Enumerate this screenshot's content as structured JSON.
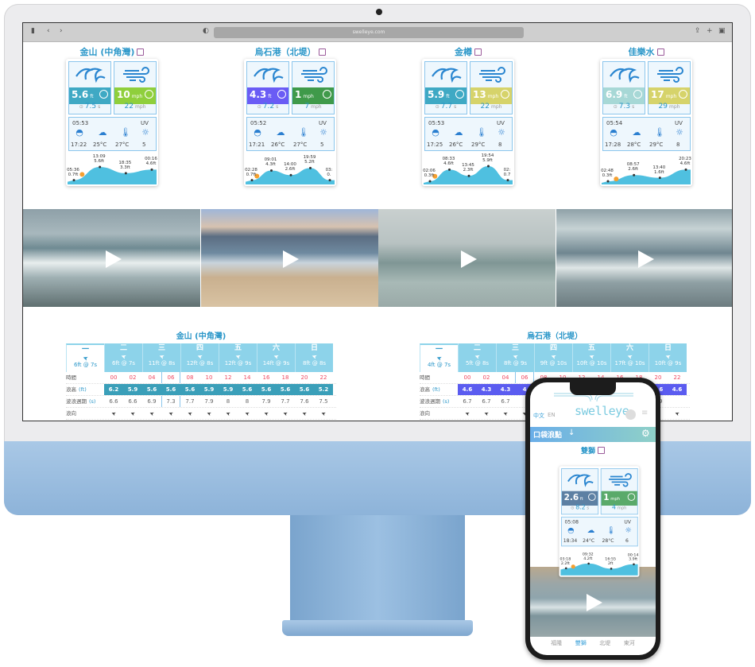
{
  "browser": {
    "url": "swelleye.com"
  },
  "spots": [
    {
      "name": "金山 (中角灣)",
      "wave_height": "5.6",
      "wave_unit": "ft",
      "wave_period": "7.5",
      "period_unit": "s",
      "wave_color": "#3fa9c4",
      "wind_speed": "10",
      "wind_unit": "mph",
      "wind_gust": "22",
      "wind_color": "#8fcf3c",
      "sunrise": "05:53",
      "sunset": "17:22",
      "uv_label": "UV",
      "air_temp": "25°C",
      "water_temp": "27°C",
      "uv": "5",
      "tides": [
        {
          "time": "05:36",
          "height": "0.7ft",
          "v": 0.7
        },
        {
          "time": "13:09",
          "height": "5.6ft",
          "v": 5.6
        },
        {
          "time": "18:35",
          "height": "3.3ft",
          "v": 3.3
        },
        {
          "time": "00:16",
          "height": "4.6ft",
          "v": 4.6
        }
      ]
    },
    {
      "name": "烏石港（北堤）",
      "wave_height": "4.3",
      "wave_unit": "ft",
      "wave_period": "7.2",
      "period_unit": "s",
      "wave_color": "#6a5cf5",
      "wind_speed": "1",
      "wind_unit": "mph",
      "wind_gust": "7",
      "wind_color": "#3f9a4a",
      "sunrise": "05:52",
      "sunset": "17:21",
      "uv_label": "UV",
      "air_temp": "26°C",
      "water_temp": "27°C",
      "uv": "5",
      "tides": [
        {
          "time": "02:28",
          "height": "0.7ft",
          "v": 0.7
        },
        {
          "time": "09:01",
          "height": "4.3ft",
          "v": 4.3
        },
        {
          "time": "14:00",
          "height": "2.6ft",
          "v": 2.6
        },
        {
          "time": "19:59",
          "height": "5.2ft",
          "v": 5.2
        },
        {
          "time": "03:",
          "height": "0.",
          "v": 0.7
        }
      ]
    },
    {
      "name": "金樽",
      "wave_height": "5.9",
      "wave_unit": "ft",
      "wave_period": "7.7",
      "period_unit": "s",
      "wave_color": "#3fa9c4",
      "wind_speed": "13",
      "wind_unit": "mph",
      "wind_gust": "22",
      "wind_color": "#d6d36a",
      "sunrise": "05:53",
      "sunset": "17:25",
      "uv_label": "UV",
      "air_temp": "26°C",
      "water_temp": "29°C",
      "uv": "8",
      "tides": [
        {
          "time": "02:06",
          "height": "0.3ft",
          "v": 0.3
        },
        {
          "time": "08:33",
          "height": "4.6ft",
          "v": 4.6
        },
        {
          "time": "13:45",
          "height": "2.3ft",
          "v": 2.3
        },
        {
          "time": "19:54",
          "height": "5.9ft",
          "v": 5.9
        },
        {
          "time": "02:",
          "height": "0.7",
          "v": 0.7
        }
      ]
    },
    {
      "name": "佳樂水",
      "wave_height": "6.9",
      "wave_unit": "ft",
      "wave_period": "7.3",
      "period_unit": "s",
      "wave_color": "#a7d8d6",
      "wind_speed": "17",
      "wind_unit": "mph",
      "wind_gust": "29",
      "wind_color": "#d6d36a",
      "sunrise": "05:54",
      "sunset": "17:28",
      "uv_label": "UV",
      "air_temp": "28°C",
      "water_temp": "29°C",
      "uv": "8",
      "tides": [
        {
          "time": "02:48",
          "height": "0.3ft",
          "v": 0.3
        },
        {
          "time": "08:57",
          "height": "2.6ft",
          "v": 2.6
        },
        {
          "time": "13:40",
          "height": "1.6ft",
          "v": 1.6
        },
        {
          "time": "20:23",
          "height": "4.6ft",
          "v": 4.6
        }
      ]
    }
  ],
  "forecast_tables": [
    {
      "title": "金山 (中角灣)",
      "bar_color": "#3a9fb9",
      "days": [
        {
          "day": "一",
          "swell": "6ft @ 7s"
        },
        {
          "day": "二",
          "swell": "6ft @ 7s"
        },
        {
          "day": "三",
          "swell": "11ft @ 8s"
        },
        {
          "day": "四",
          "swell": "12ft @ 8s"
        },
        {
          "day": "五",
          "swell": "12ft @ 9s"
        },
        {
          "day": "六",
          "swell": "14ft @ 9s"
        },
        {
          "day": "日",
          "swell": "8ft @ 8s"
        }
      ],
      "row_labels": {
        "time": "時間",
        "height": "浪高",
        "height_unit": "(ft)",
        "period": "波浪週期",
        "period_unit": "(s)",
        "direction": "浪向"
      },
      "hours": [
        "00",
        "02",
        "04",
        "06",
        "08",
        "10",
        "12",
        "14",
        "16",
        "18",
        "20",
        "22"
      ],
      "heights": [
        "6.2",
        "5.9",
        "5.6",
        "5.6",
        "5.6",
        "5.9",
        "5.9",
        "5.6",
        "5.6",
        "5.6",
        "5.6",
        "5.2"
      ],
      "periods": [
        "6.6",
        "6.6",
        "6.9",
        "7.3",
        "7.7",
        "7.9",
        "8",
        "8",
        "7.9",
        "7.7",
        "7.6",
        "7.5"
      ]
    },
    {
      "title": "烏石港（北堤）",
      "bar_color": "#5b5cf0",
      "days": [
        {
          "day": "一",
          "swell": "4ft @ 7s"
        },
        {
          "day": "二",
          "swell": "5ft @ 8s"
        },
        {
          "day": "三",
          "swell": "8ft @ 9s"
        },
        {
          "day": "四",
          "swell": "9ft @ 10s"
        },
        {
          "day": "五",
          "swell": "10ft @ 10s"
        },
        {
          "day": "六",
          "swell": "17ft @ 10s"
        },
        {
          "day": "日",
          "swell": "10ft @ 9s"
        }
      ],
      "row_labels": {
        "time": "時間",
        "height": "浪高",
        "height_unit": "(ft)",
        "period": "波浪週期",
        "period_unit": "(s)",
        "direction": "浪向"
      },
      "hours": [
        "00",
        "02",
        "04",
        "06",
        "08",
        "10",
        "12",
        "14",
        "16",
        "18",
        "20",
        "22"
      ],
      "heights": [
        "4.6",
        "4.3",
        "4.3",
        "4",
        "",
        "",
        "",
        "",
        "",
        "",
        "4.6",
        "4.6"
      ],
      "periods": [
        "6.7",
        "6.7",
        "6.7",
        "",
        "",
        "",
        "",
        "",
        "",
        "7.9",
        "7.9"
      ]
    }
  ],
  "phone": {
    "lang_zh": "中文",
    "lang_en": "EN",
    "logo": "swelleye",
    "favorites_label": "口袋浪點",
    "spot": {
      "name": "雙獅",
      "wave_height": "2.6",
      "wave_unit": "ft",
      "wave_period": "8.2",
      "period_unit": "s",
      "wave_color": "#5d80a3",
      "wind_speed": "1",
      "wind_unit": "mph",
      "wind_gust": "4",
      "wind_color": "#5aaa6a",
      "sunrise": "05:08",
      "sunset": "18:34",
      "uv_label": "UV",
      "air_temp": "24°C",
      "water_temp": "28°C",
      "uv": "6",
      "tides": [
        {
          "time": "03:18",
          "height": "2.2ft",
          "v": 2.2
        },
        {
          "time": "09:32",
          "height": "4.2ft",
          "v": 4.2
        },
        {
          "time": "16:55",
          "height": "2ft",
          "v": 2.0
        },
        {
          "time": "00:14",
          "height": "3.9ft",
          "v": 3.9
        }
      ]
    },
    "nav": [
      {
        "label": "福隆",
        "active": false
      },
      {
        "label": "雙獅",
        "active": true
      },
      {
        "label": "北堤",
        "active": false
      },
      {
        "label": "東河",
        "active": false
      }
    ],
    "accent": "#3aa0d8"
  }
}
